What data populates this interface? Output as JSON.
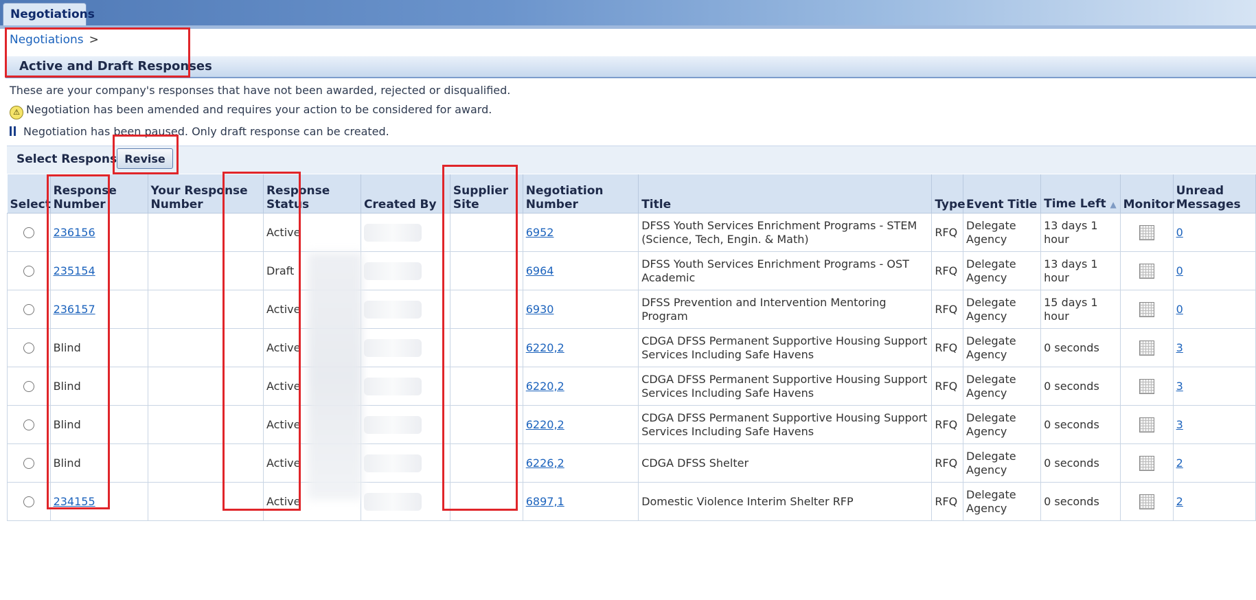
{
  "tab": {
    "label": "Negotiations"
  },
  "breadcrumb": {
    "link": "Negotiations",
    "separator": ">"
  },
  "header": {
    "title": "Active and Draft Responses"
  },
  "descriptions": {
    "line1": "These are your company's responses that have not been awarded, rejected or disqualified.",
    "line2": "Negotiation has been amended and requires your action to be considered for award.",
    "line3": "Negotiation has been paused. Only draft response can be created."
  },
  "select_bar": {
    "label": "Select Response:",
    "revise_label": "Revise"
  },
  "table": {
    "headers": {
      "select": "Select",
      "response_number": "Response Number",
      "your_response_number": "Your Response Number",
      "response_status": "Response Status",
      "created_by": "Created By",
      "supplier_site": "Supplier Site",
      "negotiation_number": "Negotiation Number",
      "title": "Title",
      "type": "Type",
      "event_title": "Event Title",
      "time_left": "Time Left",
      "sort_indicator": "▲",
      "monitor": "Monitor",
      "unread_messages": "Unread Messages"
    },
    "rows": [
      {
        "response_number": "236156",
        "response_link": true,
        "status": "Active",
        "negotiation_number": "6952",
        "title": "DFSS Youth Services Enrichment Programs - STEM (Science, Tech, Engin. & Math)",
        "type": "RFQ",
        "event_title": "Delegate Agency",
        "time_left": "13 days 1 hour",
        "unread": "0"
      },
      {
        "response_number": "235154",
        "response_link": true,
        "status": "Draft",
        "negotiation_number": "6964",
        "title": "DFSS Youth Services Enrichment Programs - OST Academic",
        "type": "RFQ",
        "event_title": "Delegate Agency",
        "time_left": "13 days 1 hour",
        "unread": "0"
      },
      {
        "response_number": "236157",
        "response_link": true,
        "status": "Active",
        "negotiation_number": "6930",
        "title": "DFSS Prevention and Intervention Mentoring Program",
        "type": "RFQ",
        "event_title": "Delegate Agency",
        "time_left": "15 days 1 hour",
        "unread": "0"
      },
      {
        "response_number": "Blind",
        "response_link": false,
        "status": "Active",
        "negotiation_number": "6220,2",
        "title": "CDGA DFSS Permanent Supportive Housing Support Services Including Safe Havens",
        "type": "RFQ",
        "event_title": "Delegate Agency",
        "time_left": "0 seconds",
        "unread": "3"
      },
      {
        "response_number": "Blind",
        "response_link": false,
        "status": "Active",
        "negotiation_number": "6220,2",
        "title": "CDGA DFSS Permanent Supportive Housing Support Services Including Safe Havens",
        "type": "RFQ",
        "event_title": "Delegate Agency",
        "time_left": "0 seconds",
        "unread": "3"
      },
      {
        "response_number": "Blind",
        "response_link": false,
        "status": "Active",
        "negotiation_number": "6220,2",
        "title": "CDGA DFSS Permanent Supportive Housing Support Services Including Safe Havens",
        "type": "RFQ",
        "event_title": "Delegate Agency",
        "time_left": "0 seconds",
        "unread": "3"
      },
      {
        "response_number": "Blind",
        "response_link": false,
        "status": "Active",
        "negotiation_number": "6226,2",
        "title": "CDGA DFSS Shelter",
        "type": "RFQ",
        "event_title": "Delegate Agency",
        "time_left": "0 seconds",
        "unread": "2"
      },
      {
        "response_number": "234155",
        "response_link": true,
        "status": "Active",
        "negotiation_number": "6897,1",
        "title": "Domestic Violence Interim Shelter RFP",
        "type": "RFQ",
        "event_title": "Delegate Agency",
        "time_left": "0 seconds",
        "unread": "2"
      }
    ]
  },
  "icons": {
    "warning": "warning-icon",
    "pause": "pause-icon",
    "monitor": "monitor-grid-icon",
    "radio": "radio-button"
  },
  "colors": {
    "annotation_box": "#e0252a",
    "link": "#1c63bd",
    "header_bg": "#d5e2f2"
  }
}
